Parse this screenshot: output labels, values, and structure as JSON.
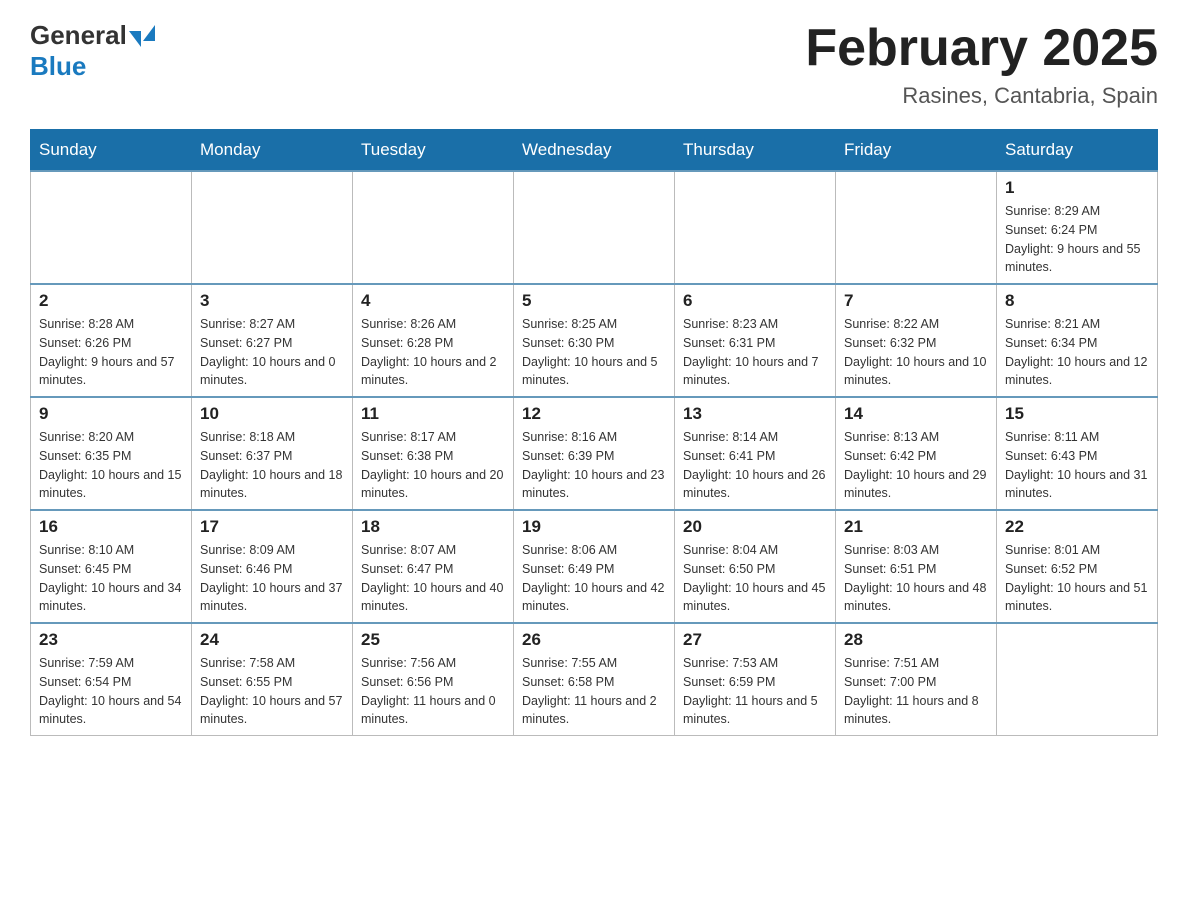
{
  "header": {
    "logo_general": "General",
    "logo_blue": "Blue",
    "title": "February 2025",
    "subtitle": "Rasines, Cantabria, Spain"
  },
  "days_of_week": [
    "Sunday",
    "Monday",
    "Tuesday",
    "Wednesday",
    "Thursday",
    "Friday",
    "Saturday"
  ],
  "weeks": [
    [
      {
        "day": "",
        "info": ""
      },
      {
        "day": "",
        "info": ""
      },
      {
        "day": "",
        "info": ""
      },
      {
        "day": "",
        "info": ""
      },
      {
        "day": "",
        "info": ""
      },
      {
        "day": "",
        "info": ""
      },
      {
        "day": "1",
        "info": "Sunrise: 8:29 AM\nSunset: 6:24 PM\nDaylight: 9 hours and 55 minutes."
      }
    ],
    [
      {
        "day": "2",
        "info": "Sunrise: 8:28 AM\nSunset: 6:26 PM\nDaylight: 9 hours and 57 minutes."
      },
      {
        "day": "3",
        "info": "Sunrise: 8:27 AM\nSunset: 6:27 PM\nDaylight: 10 hours and 0 minutes."
      },
      {
        "day": "4",
        "info": "Sunrise: 8:26 AM\nSunset: 6:28 PM\nDaylight: 10 hours and 2 minutes."
      },
      {
        "day": "5",
        "info": "Sunrise: 8:25 AM\nSunset: 6:30 PM\nDaylight: 10 hours and 5 minutes."
      },
      {
        "day": "6",
        "info": "Sunrise: 8:23 AM\nSunset: 6:31 PM\nDaylight: 10 hours and 7 minutes."
      },
      {
        "day": "7",
        "info": "Sunrise: 8:22 AM\nSunset: 6:32 PM\nDaylight: 10 hours and 10 minutes."
      },
      {
        "day": "8",
        "info": "Sunrise: 8:21 AM\nSunset: 6:34 PM\nDaylight: 10 hours and 12 minutes."
      }
    ],
    [
      {
        "day": "9",
        "info": "Sunrise: 8:20 AM\nSunset: 6:35 PM\nDaylight: 10 hours and 15 minutes."
      },
      {
        "day": "10",
        "info": "Sunrise: 8:18 AM\nSunset: 6:37 PM\nDaylight: 10 hours and 18 minutes."
      },
      {
        "day": "11",
        "info": "Sunrise: 8:17 AM\nSunset: 6:38 PM\nDaylight: 10 hours and 20 minutes."
      },
      {
        "day": "12",
        "info": "Sunrise: 8:16 AM\nSunset: 6:39 PM\nDaylight: 10 hours and 23 minutes."
      },
      {
        "day": "13",
        "info": "Sunrise: 8:14 AM\nSunset: 6:41 PM\nDaylight: 10 hours and 26 minutes."
      },
      {
        "day": "14",
        "info": "Sunrise: 8:13 AM\nSunset: 6:42 PM\nDaylight: 10 hours and 29 minutes."
      },
      {
        "day": "15",
        "info": "Sunrise: 8:11 AM\nSunset: 6:43 PM\nDaylight: 10 hours and 31 minutes."
      }
    ],
    [
      {
        "day": "16",
        "info": "Sunrise: 8:10 AM\nSunset: 6:45 PM\nDaylight: 10 hours and 34 minutes."
      },
      {
        "day": "17",
        "info": "Sunrise: 8:09 AM\nSunset: 6:46 PM\nDaylight: 10 hours and 37 minutes."
      },
      {
        "day": "18",
        "info": "Sunrise: 8:07 AM\nSunset: 6:47 PM\nDaylight: 10 hours and 40 minutes."
      },
      {
        "day": "19",
        "info": "Sunrise: 8:06 AM\nSunset: 6:49 PM\nDaylight: 10 hours and 42 minutes."
      },
      {
        "day": "20",
        "info": "Sunrise: 8:04 AM\nSunset: 6:50 PM\nDaylight: 10 hours and 45 minutes."
      },
      {
        "day": "21",
        "info": "Sunrise: 8:03 AM\nSunset: 6:51 PM\nDaylight: 10 hours and 48 minutes."
      },
      {
        "day": "22",
        "info": "Sunrise: 8:01 AM\nSunset: 6:52 PM\nDaylight: 10 hours and 51 minutes."
      }
    ],
    [
      {
        "day": "23",
        "info": "Sunrise: 7:59 AM\nSunset: 6:54 PM\nDaylight: 10 hours and 54 minutes."
      },
      {
        "day": "24",
        "info": "Sunrise: 7:58 AM\nSunset: 6:55 PM\nDaylight: 10 hours and 57 minutes."
      },
      {
        "day": "25",
        "info": "Sunrise: 7:56 AM\nSunset: 6:56 PM\nDaylight: 11 hours and 0 minutes."
      },
      {
        "day": "26",
        "info": "Sunrise: 7:55 AM\nSunset: 6:58 PM\nDaylight: 11 hours and 2 minutes."
      },
      {
        "day": "27",
        "info": "Sunrise: 7:53 AM\nSunset: 6:59 PM\nDaylight: 11 hours and 5 minutes."
      },
      {
        "day": "28",
        "info": "Sunrise: 7:51 AM\nSunset: 7:00 PM\nDaylight: 11 hours and 8 minutes."
      },
      {
        "day": "",
        "info": ""
      }
    ]
  ]
}
